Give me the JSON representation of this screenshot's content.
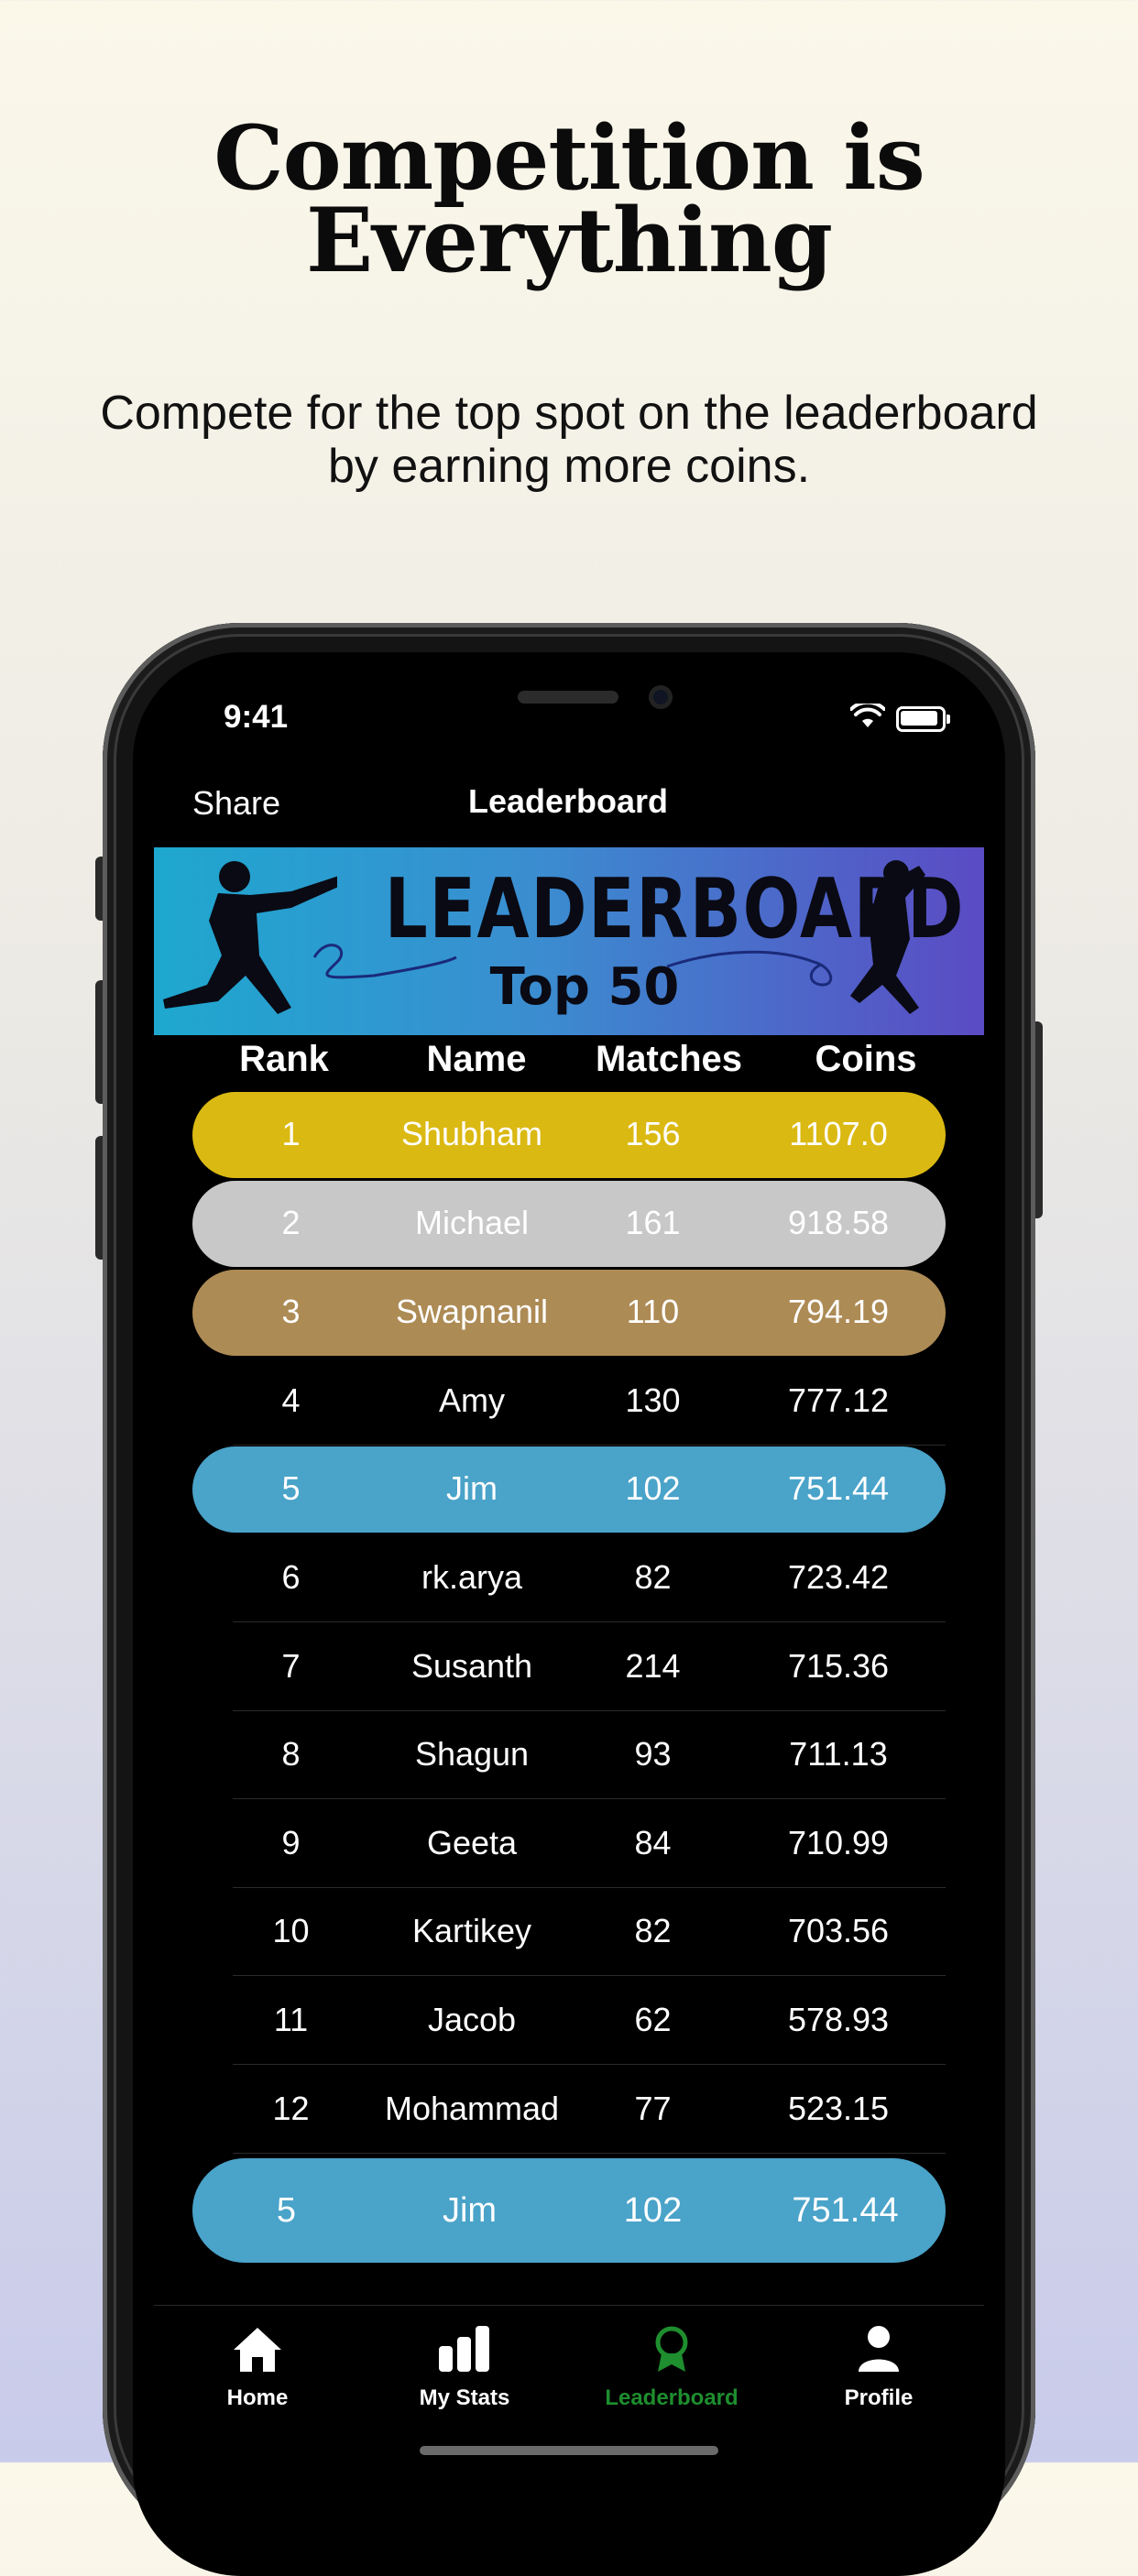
{
  "promo": {
    "headline_line1": "Competition is",
    "headline_line2": "Everything",
    "subline_line1": "Compete for the top spot on the leaderboard",
    "subline_line2": "by earning more coins."
  },
  "status_bar": {
    "time": "9:41",
    "wifi_icon": "wifi-icon",
    "battery_icon": "battery-icon"
  },
  "nav": {
    "share_label": "Share",
    "title": "Leaderboard"
  },
  "banner": {
    "title": "LEADERBOARD",
    "subtitle": "Top 50",
    "colors": [
      "#1ea8cf",
      "#5b4bc4"
    ]
  },
  "table": {
    "headers": {
      "rank": "Rank",
      "name": "Name",
      "matches": "Matches",
      "coins": "Coins"
    },
    "rows": [
      {
        "rank": "1",
        "name": "Shubham",
        "matches": "156",
        "coins": "1107.0",
        "highlight": "#dbb913"
      },
      {
        "rank": "2",
        "name": "Michael",
        "matches": "161",
        "coins": "918.58",
        "highlight": "#c8c8c8"
      },
      {
        "rank": "3",
        "name": "Swapnanil",
        "matches": "110",
        "coins": "794.19",
        "highlight": "#ad8b55"
      },
      {
        "rank": "4",
        "name": "Amy",
        "matches": "130",
        "coins": "777.12"
      },
      {
        "rank": "5",
        "name": "Jim",
        "matches": "102",
        "coins": "751.44",
        "highlight": "#4aa3c9"
      },
      {
        "rank": "6",
        "name": "rk.arya",
        "matches": "82",
        "coins": "723.42"
      },
      {
        "rank": "7",
        "name": "Susanth",
        "matches": "214",
        "coins": "715.36"
      },
      {
        "rank": "8",
        "name": "Shagun",
        "matches": "93",
        "coins": "711.13"
      },
      {
        "rank": "9",
        "name": "Geeta",
        "matches": "84",
        "coins": "710.99"
      },
      {
        "rank": "10",
        "name": "Kartikey",
        "matches": "82",
        "coins": "703.56"
      },
      {
        "rank": "11",
        "name": "Jacob",
        "matches": "62",
        "coins": "578.93"
      },
      {
        "rank": "12",
        "name": "Mohammad",
        "matches": "77",
        "coins": "523.15"
      }
    ],
    "current_user": {
      "rank": "5",
      "name": "Jim",
      "matches": "102",
      "coins": "751.44"
    }
  },
  "tabbar": {
    "items": [
      {
        "label": "Home",
        "icon": "house-icon"
      },
      {
        "label": "My Stats",
        "icon": "bar-chart-icon"
      },
      {
        "label": "Leaderboard",
        "icon": "award-ribbon-icon",
        "active": true,
        "active_color": "#1e8e2e"
      },
      {
        "label": "Profile",
        "icon": "person-icon"
      }
    ]
  }
}
